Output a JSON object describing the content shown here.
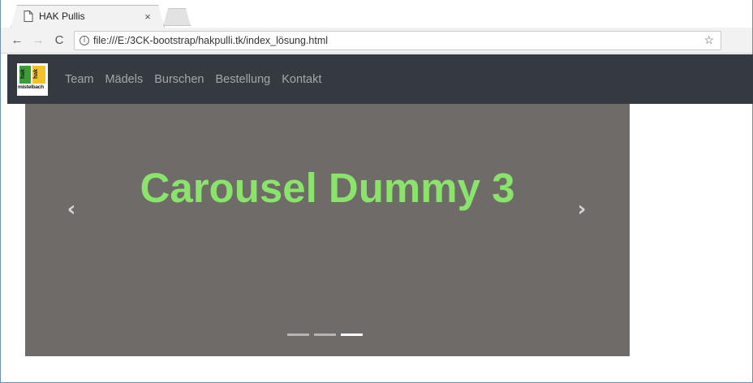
{
  "browser": {
    "tab_title": "HAK Pullis",
    "tab_close": "×",
    "url": "file:///E:/3CK-bootstrap/hakpulli.tk/index_lösung.html",
    "back": "←",
    "forward": "→",
    "reload": "C",
    "info": "i",
    "bookmark_star": "☆"
  },
  "navbar": {
    "brand_text": "mistelbach",
    "brand_tile_left": "hak",
    "brand_tile_right": "hak",
    "links": [
      "Team",
      "Mädels",
      "Burschen",
      "Bestellung",
      "Kontakt"
    ]
  },
  "carousel": {
    "slide_title": "Carousel Dummy 3",
    "prev": "‹",
    "next": "›",
    "indicator_count": 3,
    "active_index": 2,
    "background": "#6f6b69",
    "text_color": "#8ae36a"
  }
}
